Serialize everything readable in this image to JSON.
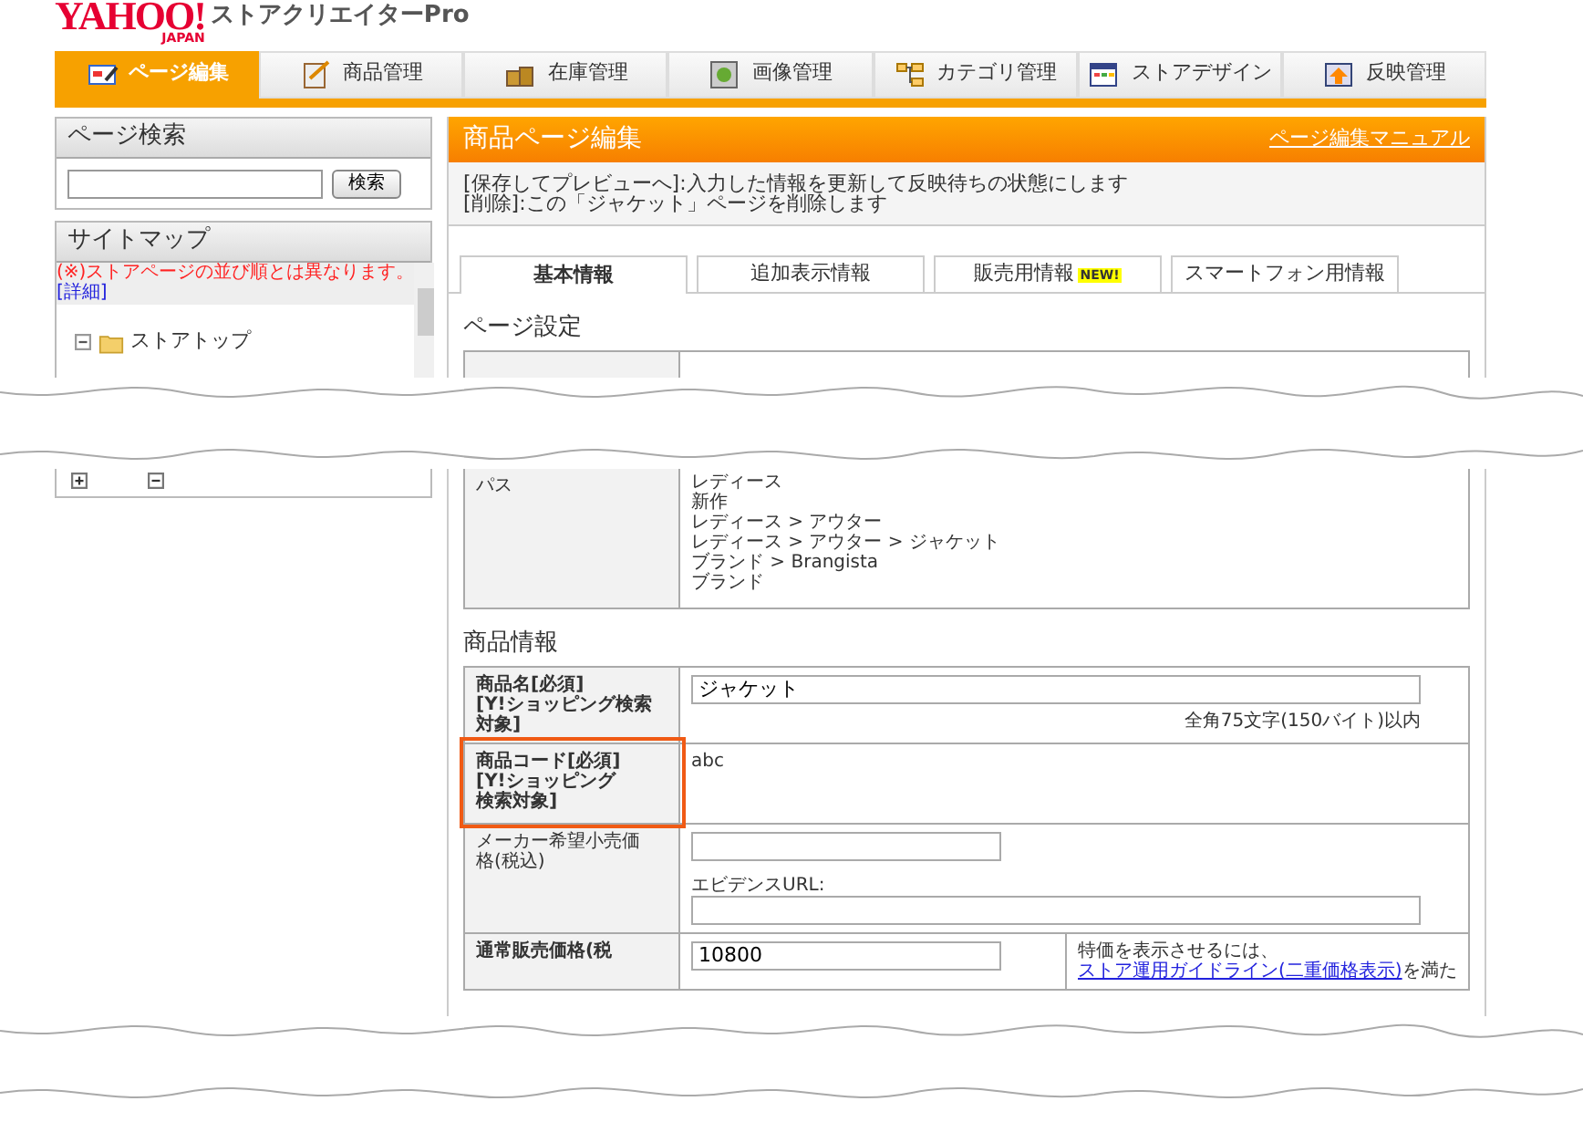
{
  "header": {
    "logo": "YAHOO!",
    "logo_sub": "JAPAN",
    "app_title": "ストアクリエイターPro"
  },
  "nav_tabs": [
    {
      "label": "ページ編集",
      "selected": true
    },
    {
      "label": "商品管理",
      "selected": false
    },
    {
      "label": "在庫管理",
      "selected": false
    },
    {
      "label": "画像管理",
      "selected": false
    },
    {
      "label": "カテゴリ管理",
      "selected": false
    },
    {
      "label": "ストアデザイン",
      "selected": false
    },
    {
      "label": "反映管理",
      "selected": false
    }
  ],
  "sidebar": {
    "search": {
      "title": "ページ検索",
      "button": "検索"
    },
    "sitemap": {
      "title": "サイトマップ",
      "notice": "(※)ストアページの並び順とは異なります。",
      "detail_link": "[詳細]",
      "tree": [
        {
          "label": "ストアトップ",
          "expanded": true
        }
      ]
    }
  },
  "main": {
    "title": "商品ページ編集",
    "manual_link": "ページ編集マニュアル",
    "info_lines": [
      "[保存してプレビューへ]:入力した情報を更新して反映待ちの状態にします",
      "[削除]:この「ジャケット」ページを削除します"
    ],
    "tabs": [
      {
        "label": "基本情報",
        "selected": true
      },
      {
        "label": "追加表示情報",
        "selected": false
      },
      {
        "label": "販売用情報",
        "selected": false,
        "badge": "NEW!"
      },
      {
        "label": "スマートフォン用情報",
        "selected": false
      }
    ],
    "page_settings": {
      "heading": "ページ設定",
      "path_label": "パス",
      "paths": [
        "レディース",
        "新作",
        "レディース > アウター",
        "レディース > アウター > ジャケット",
        "ブランド > Brangista",
        "ブランド"
      ]
    },
    "product_info": {
      "heading": "商品情報",
      "rows": [
        {
          "kind": "text_input",
          "label_lines": [
            "商品名[必須]",
            "[Y!ショッピング検索",
            "対象]"
          ],
          "required": true,
          "highlighted": false,
          "value": "ジャケット",
          "note": "全角75文字(150バイト)以内"
        },
        {
          "kind": "static",
          "label_lines": [
            "商品コード[必須]",
            "[Y!ショッピング",
            "検索対象]"
          ],
          "required": true,
          "highlighted": true,
          "value": "abc"
        },
        {
          "kind": "price_evidence",
          "label_lines": [
            "メーカー希望小売価",
            "格(税込)"
          ],
          "required": false,
          "highlighted": false,
          "evidence_label": "エビデンスURL:"
        },
        {
          "kind": "price_note",
          "label_lines": [
            "通常販売価格(税"
          ],
          "required": true,
          "highlighted": false,
          "value": "10800",
          "note": "特価を表示させるには、",
          "note_link": "ストア運用ガイドライン(二重価格表示)",
          "note_tail": "を満た"
        }
      ]
    }
  }
}
